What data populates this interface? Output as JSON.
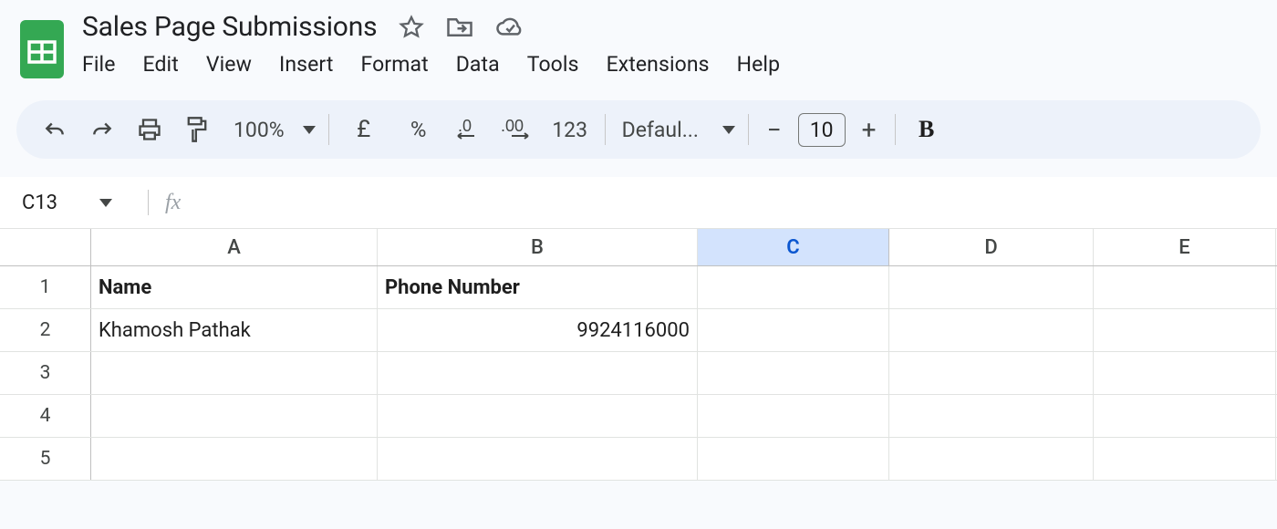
{
  "doc": {
    "title": "Sales Page Submissions"
  },
  "menus": [
    "File",
    "Edit",
    "View",
    "Insert",
    "Format",
    "Data",
    "Tools",
    "Extensions",
    "Help"
  ],
  "toolbar": {
    "zoom": "100%",
    "currency": "£",
    "percent": "%",
    "decimal_dec": ".0",
    "decimal_inc": ".00",
    "num_format": "123",
    "font_name": "Defaul...",
    "font_size": "10",
    "bold": "B"
  },
  "cell_ref": "C13",
  "fx_label": "fx",
  "columns": [
    "A",
    "B",
    "C",
    "D",
    "E"
  ],
  "selected_column": "C",
  "rows": [
    {
      "num": "1",
      "A": "Name",
      "B": "Phone Number",
      "bold": true,
      "b_align": "left"
    },
    {
      "num": "2",
      "A": "Khamosh Pathak",
      "B": "9924116000",
      "bold": false,
      "b_align": "right"
    },
    {
      "num": "3",
      "A": "",
      "B": ""
    },
    {
      "num": "4",
      "A": "",
      "B": ""
    },
    {
      "num": "5",
      "A": "",
      "B": ""
    }
  ]
}
